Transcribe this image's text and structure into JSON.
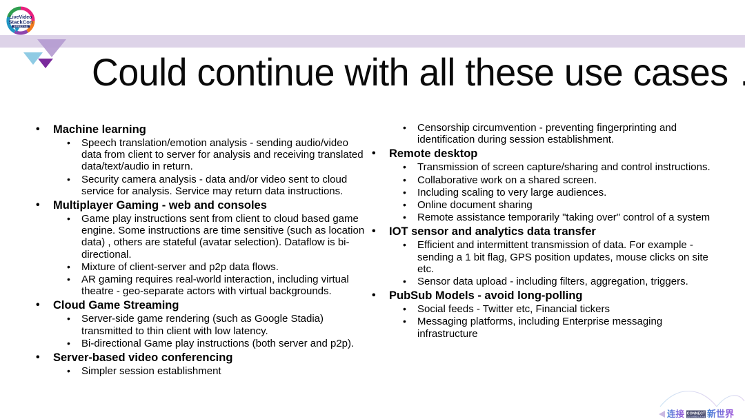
{
  "slide": {
    "title": "Could continue with all these use cases …",
    "logo_text_line1": "LiveVideo",
    "logo_text_line2": "StackCon",
    "logo_text_line3": "音视频技术大会",
    "watermark": {
      "cn_left": "连接",
      "en_middle": "CONNECT",
      "en_middle_sub": "全球 音视频 技术大会",
      "cn_right": "新世界"
    },
    "colors": {
      "band_lavender": "#ddd3e8",
      "triangle_large": "#b49bd0",
      "triangle_blue": "#8fcbe4",
      "triangle_dark": "#7a2a9c",
      "text": "#000000",
      "watermark_blue": "#4a6fd4",
      "watermark_purple": "#8a4fd8"
    }
  },
  "columns": {
    "left": [
      {
        "label": "Machine learning",
        "children": [
          "Speech translation/emotion analysis  - sending audio/video data from client to server for analysis and receiving translated data/text/audio in return.",
          "Security camera analysis - data and/or video sent to cloud service for analysis. Service may return data instructions."
        ]
      },
      {
        "label": "Multiplayer Gaming - web and consoles",
        "children": [
          "Game play instructions sent from client to cloud based game engine. Some instructions are time sensitive (such as location data) , others are stateful (avatar selection). Dataflow is bi-directional.",
          "Mixture of client-server and p2p data flows.",
          "AR gaming requires real-world interaction, including virtual theatre - geo-separate actors with virtual backgrounds."
        ]
      },
      {
        "label": "Cloud Game Streaming",
        "children": [
          "Server-side game rendering (such as Google Stadia) transmitted to thin client with low latency.",
          "Bi-directional Game play instructions (both server and p2p)."
        ]
      },
      {
        "label": "Server-based video conferencing",
        "children": [
          "Simpler session establishment"
        ]
      }
    ],
    "right": [
      {
        "label": "",
        "orphan_children": [
          "Censorship circumvention - preventing fingerprinting and identification during session establishment."
        ]
      },
      {
        "label": "Remote desktop",
        "children": [
          "Transmission of screen capture/sharing and control instructions.",
          "Collaborative work on a shared screen.",
          "Including scaling to very large audiences.",
          "Online document sharing",
          "Remote assistance temporarily \"taking over\" control of a system"
        ]
      },
      {
        "label": "IOT sensor and analytics data transfer",
        "children": [
          "Efficient and intermittent transmission of data. For example  - sending a 1 bit flag, GPS position updates, mouse clicks on site etc.",
          "Sensor data upload  - including filters, aggregation, triggers."
        ]
      },
      {
        "label": "PubSub Models - avoid long-polling",
        "children": [
          "Social feeds - Twitter etc, Financial tickers",
          "Messaging platforms, including Enterprise messaging infrastructure"
        ]
      }
    ]
  },
  "bullet_glyph": "•"
}
